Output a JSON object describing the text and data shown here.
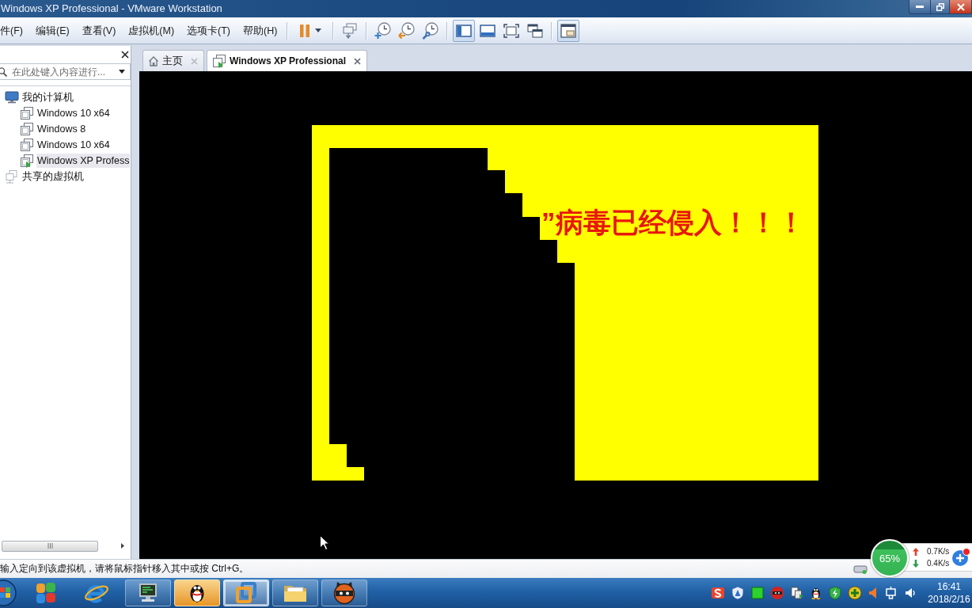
{
  "window": {
    "title": "Windows XP Professional - VMware Workstation"
  },
  "menu": [
    {
      "label": "件(F)"
    },
    {
      "label": "编辑(E)"
    },
    {
      "label": "查看(V)"
    },
    {
      "label": "虚拟机(M)"
    },
    {
      "label": "选项卡(T)"
    },
    {
      "label": "帮助(H)"
    }
  ],
  "toolbar": {
    "groups": [
      {
        "buttons": [
          {
            "selected": false
          }
        ]
      },
      {
        "buttons": [
          {
            "selected": false
          }
        ]
      },
      {
        "buttons": [
          {
            "selected": false
          },
          {
            "selected": false
          },
          {
            "selected": false
          }
        ]
      },
      {
        "buttons": [
          {
            "selected": true
          },
          {
            "selected": false
          },
          {
            "selected": false
          },
          {
            "selected": false
          }
        ]
      },
      {
        "buttons": [
          {
            "selected": true
          }
        ]
      }
    ]
  },
  "sidebar": {
    "search": {
      "placeholder": "在此处键入内容进行..."
    },
    "tree": [
      {
        "label": "我的计算机",
        "kind": "host",
        "selected": false,
        "children": [
          {
            "label": "Windows 10 x64",
            "kind": "vm",
            "selected": false,
            "running": false
          },
          {
            "label": "Windows 8",
            "kind": "vm",
            "selected": false,
            "running": false
          },
          {
            "label": "Windows 10 x64",
            "kind": "vm",
            "selected": false,
            "running": false
          },
          {
            "label": "Windows XP Profess",
            "kind": "vm",
            "selected": true,
            "running": true
          }
        ]
      },
      {
        "label": "共享的虚拟机",
        "kind": "shared",
        "selected": false
      }
    ]
  },
  "tabs": [
    {
      "label": "主页",
      "kind": "home",
      "selected": false
    },
    {
      "label": "Windows XP Professional",
      "kind": "vm",
      "selected": true
    }
  ],
  "vm_screen": {
    "message": "”病毒已经侵入！！！"
  },
  "status_bar": {
    "text": "输入定向到该虚拟机，请将鼠标指针移入其中或按 Ctrl+G。"
  },
  "net_monitor": {
    "usage": "65%",
    "upload": "0.7K/s",
    "download": "0.4K/s"
  },
  "taskbar": {
    "apps": [
      {
        "kind": "pinned",
        "selected": false,
        "flashing": false
      },
      {
        "kind": "pinned",
        "selected": false,
        "flashing": false
      },
      {
        "kind": "running",
        "selected": false,
        "flashing": false
      },
      {
        "kind": "running",
        "selected": false,
        "flashing": true
      },
      {
        "kind": "running",
        "selected": true,
        "flashing": false
      },
      {
        "kind": "running",
        "selected": false,
        "flashing": false
      },
      {
        "kind": "running",
        "selected": false,
        "flashing": false
      }
    ],
    "clock": {
      "time": "16:41",
      "date": "2018/2/16"
    }
  }
}
